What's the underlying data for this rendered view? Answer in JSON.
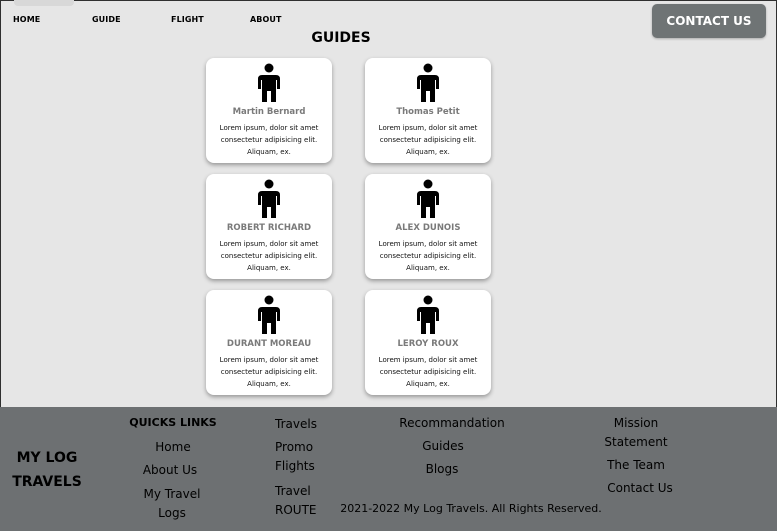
{
  "nav": {
    "home": "HOME",
    "guide": "GUIDE",
    "flight": "FLIGHT",
    "about": "ABOUT"
  },
  "header": {
    "contact_button": "CONTACT US"
  },
  "page_title": "GUIDES",
  "guides": [
    {
      "name": "Martin Bernard",
      "desc": "Lorem ipsum, dolor sit amet consectetur adipisicing elit. Aliquam, ex."
    },
    {
      "name": "Thomas Petit",
      "desc": "Lorem ipsum, dolor sit amet consectetur adipisicing elit. Aliquam, ex."
    },
    {
      "name": "ROBERT RICHARD",
      "desc": "Lorem ipsum, dolor sit amet consectetur adipisicing elit. Aliquam, ex."
    },
    {
      "name": "ALEX DUNOIS",
      "desc": "Lorem ipsum, dolor sit amet consectetur adipisicing elit. Aliquam, ex."
    },
    {
      "name": "DURANT MOREAU",
      "desc": "Lorem ipsum, dolor sit amet consectetur adipisicing elit. Aliquam, ex."
    },
    {
      "name": "LEROY ROUX",
      "desc": "Lorem ipsum, dolor sit amet consectetur adipisicing elit. Aliquam, ex."
    }
  ],
  "footer": {
    "brand": "MY LOG TRAVELS",
    "quick_links_title": "QUICKS LINKS",
    "quick_links": [
      "Home",
      "About Us",
      "My Travel Logs"
    ],
    "col2": [
      "Travels",
      "Promo Flights",
      "Travel ROUTE"
    ],
    "col3": [
      "Recommandation",
      "Guides",
      "Blogs"
    ],
    "col4": [
      "Mission Statement",
      "The Team",
      "Contact Us"
    ],
    "copyright": "2021-2022 My Log Travels. All Rights Reserved."
  },
  "colors": {
    "page_bg": "#e6e6e6",
    "footer_bg": "#6d7072",
    "button_bg": "#6f7475",
    "card_bg": "#ffffff",
    "name_text": "#7a7a7a"
  }
}
